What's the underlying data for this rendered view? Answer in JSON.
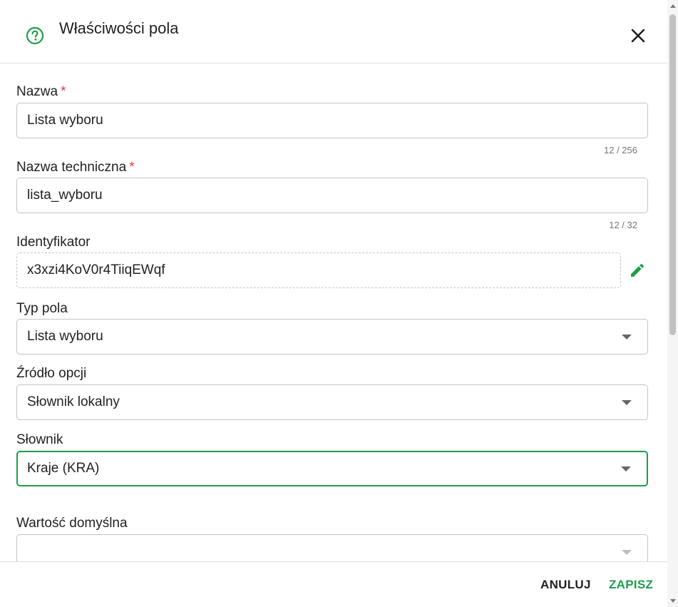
{
  "header": {
    "title": "Właściwości pola",
    "help_icon": "help-circle-icon",
    "close_icon": "close-icon"
  },
  "fields": {
    "name": {
      "label": "Nazwa",
      "required": "*",
      "value": "Lista wyboru",
      "counter": "12 / 256"
    },
    "technical_name": {
      "label": "Nazwa techniczna",
      "required": "*",
      "value": "lista_wyboru",
      "counter": "12 / 32"
    },
    "identifier": {
      "label": "Identyfikator",
      "value": "x3xzi4KoV0r4TiiqEWqf",
      "edit_icon": "pencil-icon"
    },
    "field_type": {
      "label": "Typ pola",
      "value": "Lista wyboru"
    },
    "option_source": {
      "label": "Źródło opcji",
      "value": "Słownik lokalny"
    },
    "dictionary": {
      "label": "Słownik",
      "value": "Kraje (KRA)"
    },
    "default_value": {
      "label": "Wartość domyślna",
      "value": ""
    }
  },
  "footer": {
    "cancel_label": "ANULUJ",
    "save_label": "ZAPISZ"
  },
  "colors": {
    "accent": "#1e9e4a",
    "required": "#e53935",
    "border": "#c4c4c4"
  }
}
